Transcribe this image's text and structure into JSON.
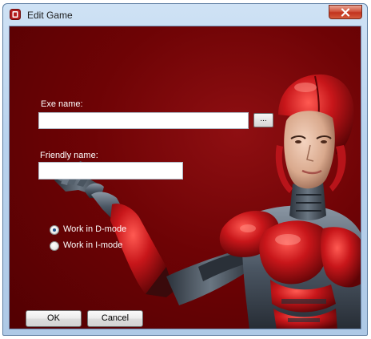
{
  "window": {
    "title": "Edit Game"
  },
  "form": {
    "exe_label": "Exe name:",
    "exe_value": "",
    "browse_label": "...",
    "friendly_label": "Friendly name:",
    "friendly_value": "",
    "mode_options": [
      {
        "label": "Work in D-mode",
        "selected": true
      },
      {
        "label": "Work in I-mode",
        "selected": false
      }
    ]
  },
  "buttons": {
    "ok_label": "OK",
    "cancel_label": "Cancel"
  },
  "colors": {
    "background_red": "#6e0305",
    "titlebar_blue": "#b9d3ee",
    "close_red": "#c2331e"
  },
  "icons": {
    "app": "app-icon",
    "close": "close-icon"
  }
}
